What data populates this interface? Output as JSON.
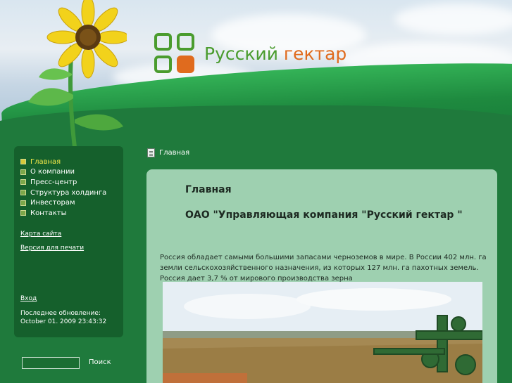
{
  "site": {
    "logo_word1": "Русский",
    "logo_word2": "гектар",
    "brand_colors": {
      "green": "#4a9c2e",
      "orange": "#e06b1e"
    }
  },
  "menu": {
    "items": [
      {
        "label": "Главная",
        "active": true
      },
      {
        "label": "О компании",
        "active": false
      },
      {
        "label": "Пресс-центр",
        "active": false
      },
      {
        "label": "Структура холдинга",
        "active": false
      },
      {
        "label": "Инвесторам",
        "active": false
      },
      {
        "label": "Контакты",
        "active": false
      }
    ]
  },
  "sidebar": {
    "sitemap": "Карта сайта",
    "print_version": "Версия для печати",
    "login": "Вход",
    "last_update_label": "Последнее обновление:",
    "last_update_value": "October 01. 2009 23:43:32",
    "search_value": "",
    "search_button": "Поиск"
  },
  "breadcrumb": {
    "label": "Главная",
    "icon": "document-icon"
  },
  "content": {
    "title": "Главная",
    "company": "ОАО \"Управляющая компания \"Русский гектар \"",
    "paragraph": "Россия обладает самыми большими запасами черноземов в мире. В России 402 млн. га земли сельскохозяйственного назначения, из которых 127 млн. га пахотных земель. Россия дает 3,7 %  от мирового производства зерна"
  }
}
